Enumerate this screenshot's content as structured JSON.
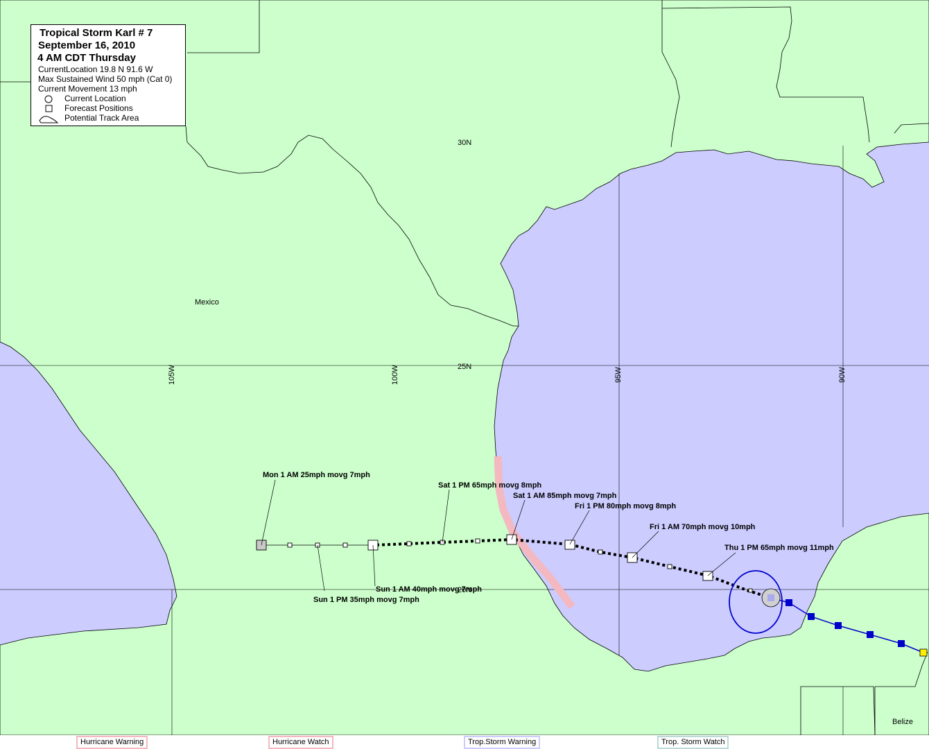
{
  "legend": {
    "title": "Tropical Storm Karl # 7",
    "date": "September 16, 2010",
    "time": "4 AM CDT Thursday",
    "current_location": "CurrentLocation 19.8 N  91.6 W",
    "max_wind": "Max Sustained Wind 50 mph (Cat 0)",
    "movement": "Current Movement 13 mph",
    "key_current": "Current Location",
    "key_forecast": "Forecast Positions",
    "key_track": "Potential Track Area"
  },
  "grid_labels": {
    "lat_30": "30N",
    "lat_25": "25N",
    "lat_20": "20N",
    "lon_105": "105W",
    "lon_100": "100W",
    "lon_95": "95W",
    "lon_90": "90W"
  },
  "place_labels": {
    "mexico": "Mexico",
    "belize": "Belize"
  },
  "forecast_labels": {
    "mon_1am": "Mon 1 AM 25mph movg 7mph",
    "sun_1pm": "Sun 1 PM 35mph movg 7mph",
    "sun_1am": "Sun 1 AM 40mph movg 7mph",
    "sat_1pm": "Sat 1 PM 65mph movg 8mph",
    "sat_1am": "Sat 1 AM 85mph movg 7mph",
    "fri_1pm": "Fri 1 PM 80mph movg 8mph",
    "fri_1am": "Fri 1 AM 70mph movg 10mph",
    "thu_1pm": "Thu 1 PM 65mph movg 11mph"
  },
  "footer": {
    "hurricane_warning": "Hurricane Warning",
    "hurricane_watch": "Hurricane  Watch",
    "ts_warning": "Trop.Storm Warning",
    "ts_watch": "Trop. Storm Watch"
  },
  "colors": {
    "land": "#ccffcc",
    "water": "#ccccff",
    "hurricane_warning": "#f4b8c0",
    "hurricane_watch": "#f4b8c0",
    "ts_warning": "#ccccff",
    "ts_watch": "#bcd8d8",
    "past_track": "#0000cc",
    "current_circle": "#0000cc"
  }
}
